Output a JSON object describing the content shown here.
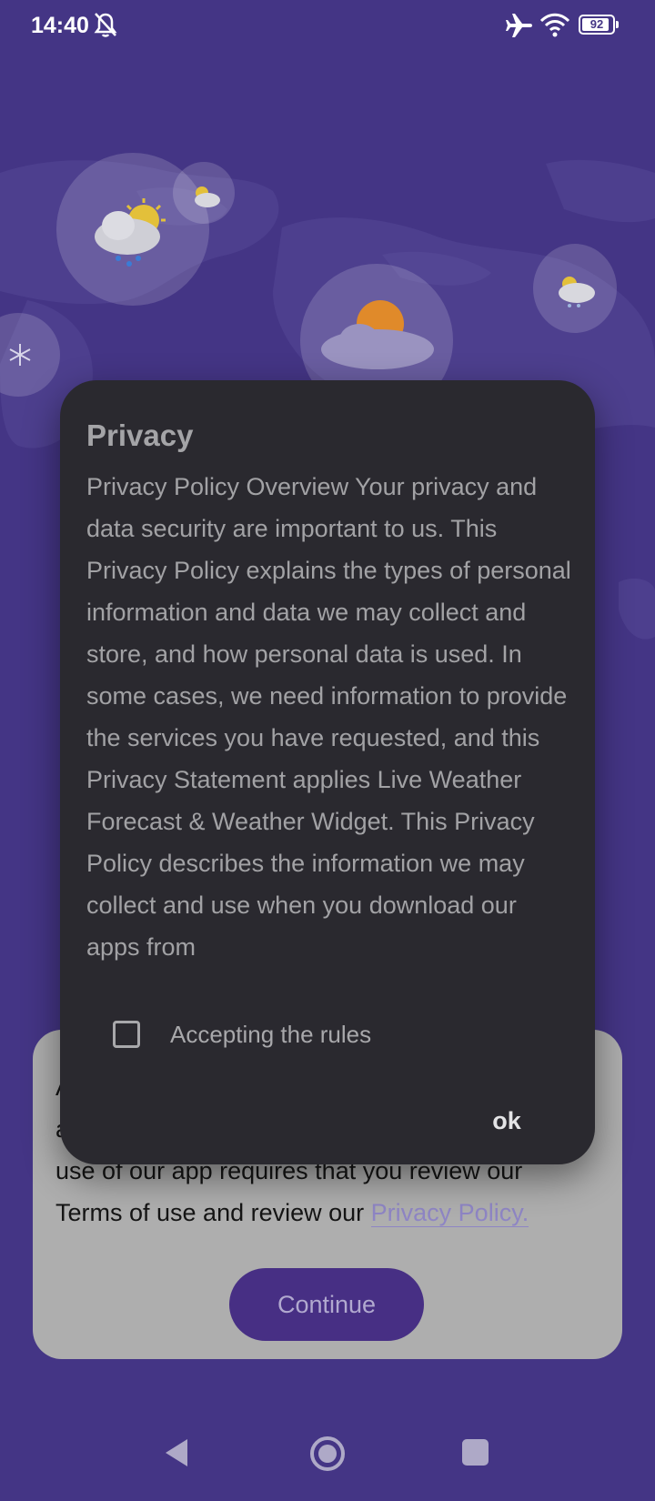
{
  "status_bar": {
    "time": "14:40",
    "battery_level": "92",
    "icons": [
      "bell-off-icon",
      "airplane-icon",
      "wifi-icon",
      "battery-icon"
    ]
  },
  "dialog": {
    "title": "Privacy",
    "body": "Privacy Policy Overview Your privacy and data security are important to us. This Privacy Policy explains the types of personal information and data we may collect and store, and how personal data is used. In some cases, we need information to provide the services you have requested, and this Privacy Statement applies Live Weather Forecast & Weather Widget. This Privacy Policy describes the information we may collect and use when you download our apps from",
    "checkbox_label": "Accepting the rules",
    "checkbox_checked": false,
    "ok_label": "ok"
  },
  "consent_card": {
    "text_partial_line1": "A",
    "text_partial_line2": "a",
    "text_line3": "use of our app requires that you review our",
    "text_line4_prefix": "Terms of use and review our ",
    "privacy_link": "Privacy Policy.",
    "continue_label": "Continue"
  },
  "nav_bar": {
    "icons": [
      "back-icon",
      "home-icon",
      "recents-icon"
    ]
  },
  "colors": {
    "background": "#443585",
    "dialog_bg": "#2a292f",
    "card_bg": "#aeaeae",
    "button_bg": "#472f84",
    "link": "#8e85c4"
  }
}
